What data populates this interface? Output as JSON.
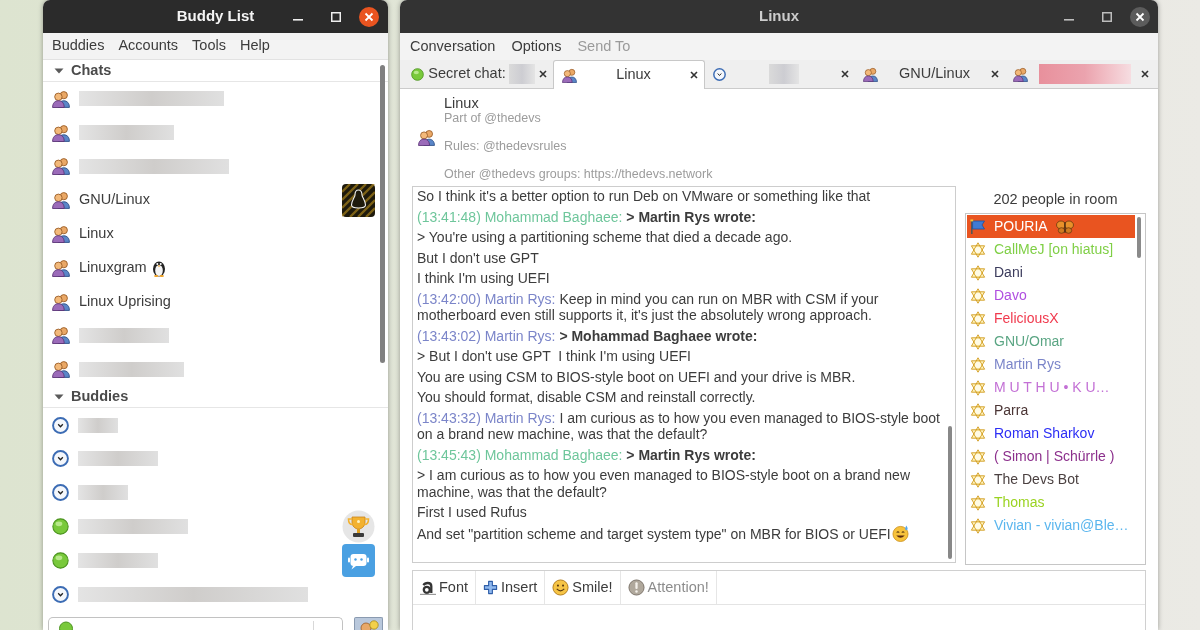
{
  "buddy_window": {
    "title": "Buddy List",
    "menu": [
      {
        "label": "Buddies"
      },
      {
        "label": "Accounts"
      },
      {
        "label": "Tools"
      },
      {
        "label": "Help"
      }
    ],
    "groups": [
      {
        "label": "Chats",
        "expanded": true,
        "items": [
          {
            "kind": "chat",
            "blurred": true
          },
          {
            "kind": "chat",
            "blurred": true
          },
          {
            "kind": "chat",
            "blurred": true
          },
          {
            "kind": "chat",
            "name": "GNU/Linux",
            "avatar": true
          },
          {
            "kind": "chat",
            "name": "Linux"
          },
          {
            "kind": "chat",
            "name": "Linuxgram",
            "emoji": true
          },
          {
            "kind": "chat",
            "name": "Linux Uprising"
          },
          {
            "kind": "chat",
            "blurred": true
          },
          {
            "kind": "chat",
            "blurred": true
          }
        ]
      },
      {
        "label": "Buddies",
        "expanded": true,
        "items": [
          {
            "kind": "away",
            "blurred": true
          },
          {
            "kind": "away",
            "blurred": true
          },
          {
            "kind": "away",
            "blurred": true
          },
          {
            "kind": "online",
            "blurred": true,
            "avatar": true
          },
          {
            "kind": "online",
            "blurred": true,
            "avatar": true
          },
          {
            "kind": "away",
            "blurred": true
          }
        ]
      }
    ],
    "status_selector": {
      "online": true
    }
  },
  "chat_window": {
    "title": "Linux",
    "menu": [
      {
        "label": "Conversation",
        "disabled": false
      },
      {
        "label": "Options",
        "disabled": false
      },
      {
        "label": "Send To",
        "disabled": true
      }
    ],
    "tabs": [
      {
        "kind": "secret",
        "label": "Secret chat:",
        "blurred": true,
        "unread": false,
        "selected": false
      },
      {
        "kind": "group",
        "label": "Linux",
        "unread": false,
        "selected": true
      },
      {
        "kind": "buddy",
        "blurred": true,
        "unread": false,
        "selected": false
      },
      {
        "kind": "group",
        "label": "GNU/Linux",
        "unread": false,
        "selected": false
      },
      {
        "kind": "group",
        "blurred": true,
        "unread": true,
        "selected": false
      }
    ],
    "header": {
      "name": "Linux",
      "subtitle": "Part of @thedevs",
      "topic": [
        "Rules: @thedevsrules",
        "Other @thedevs groups: https://thedevs.network"
      ]
    },
    "messages": [
      {
        "kind": "continuation",
        "text": "So I think it's a better option to run Deb on VMware or something like that"
      },
      {
        "kind": "quote",
        "time": "(13:41:48)",
        "sender": "Mohammad Baghaee:",
        "color": "#6ec69b",
        "quote_header": "> Martin Rys wrote:",
        "lines": [
          "> You're using a partitioning scheme that died a decade ago.",
          "But I don't use GPT",
          "I think I'm using UEFI"
        ]
      },
      {
        "kind": "plain",
        "time": "(13:42:00)",
        "sender": "Martin Rys:",
        "color": "#7b85c9",
        "text": "Keep in mind you can run on MBR with CSM if your motherboard even still supports it, it's just the absolutely wrong approach."
      },
      {
        "kind": "quote",
        "time": "(13:43:02)",
        "sender": "Martin Rys:",
        "color": "#7b85c9",
        "quote_header": "> Mohammad Baghaee wrote:",
        "lines": [
          "> But I don't use GPT  I think I'm using UEFI",
          "You are using CSM to BIOS-style boot on UEFI and your drive is MBR.",
          "You should format, disable CSM and reinstall correctly."
        ]
      },
      {
        "kind": "plain",
        "time": "(13:43:32)",
        "sender": "Martin Rys:",
        "color": "#7b85c9",
        "text": "I am curious as to how you even managed to BIOS-style boot on a brand new machine, was that the default?"
      },
      {
        "kind": "quote",
        "time": "(13:45:43)",
        "sender": "Mohammad Baghaee:",
        "color": "#6ec69b",
        "quote_header": "> Martin Rys wrote:",
        "lines": [
          "> I am curious as to how you even managed to BIOS-style boot on a brand new machine, was that the default?",
          "First I used Rufus",
          "And set \"partition scheme and target system type\" on MBR for BIOS or UEFI"
        ],
        "emoji": true
      }
    ],
    "room": {
      "count_label": "202 people in room",
      "members": [
        {
          "name": "POURIA",
          "kind": "admin",
          "selected": true,
          "emoji": true
        },
        {
          "name": "CallMeJ [on hiatus]",
          "kind": "member",
          "color": "#7fcf45",
          "selected": false
        },
        {
          "name": "Dani",
          "kind": "member",
          "color": "#3b3b5c",
          "selected": false
        },
        {
          "name": "Davo",
          "kind": "member",
          "color": "#b04ee0",
          "selected": false
        },
        {
          "name": "FeliciousX",
          "kind": "member",
          "color": "#f03a4e",
          "selected": false
        },
        {
          "name": "GNU/Omar",
          "kind": "member",
          "color": "#5aa583",
          "selected": false
        },
        {
          "name": "Martin Rys",
          "kind": "member",
          "color": "#7b85c9",
          "selected": false
        },
        {
          "name": "M U T H U • K U…",
          "kind": "member",
          "color": "#c370d5",
          "selected": false
        },
        {
          "name": "Parra",
          "kind": "member",
          "color": "#4b3535",
          "selected": false
        },
        {
          "name": "Roman Sharkov",
          "kind": "member",
          "color": "#2c2ef5",
          "selected": false
        },
        {
          "name": "( Simon | Schürrle )",
          "kind": "member",
          "color": "#8c2f8c",
          "selected": false
        },
        {
          "name": "The Devs Bot",
          "kind": "member",
          "color": "#4b4141",
          "selected": false
        },
        {
          "name": "Thomas",
          "kind": "member",
          "color": "#9ad321",
          "selected": false
        },
        {
          "name": "Vivian - vivian@Ble…",
          "kind": "member",
          "color": "#5bb6ee",
          "selected": false
        }
      ]
    },
    "toolbar": [
      {
        "kind": "font",
        "label": "Font",
        "disabled": false
      },
      {
        "kind": "insert",
        "label": "Insert",
        "disabled": false
      },
      {
        "kind": "smile",
        "label": "Smile!",
        "disabled": false
      },
      {
        "kind": "attention",
        "label": "Attention!",
        "disabled": true
      }
    ]
  }
}
